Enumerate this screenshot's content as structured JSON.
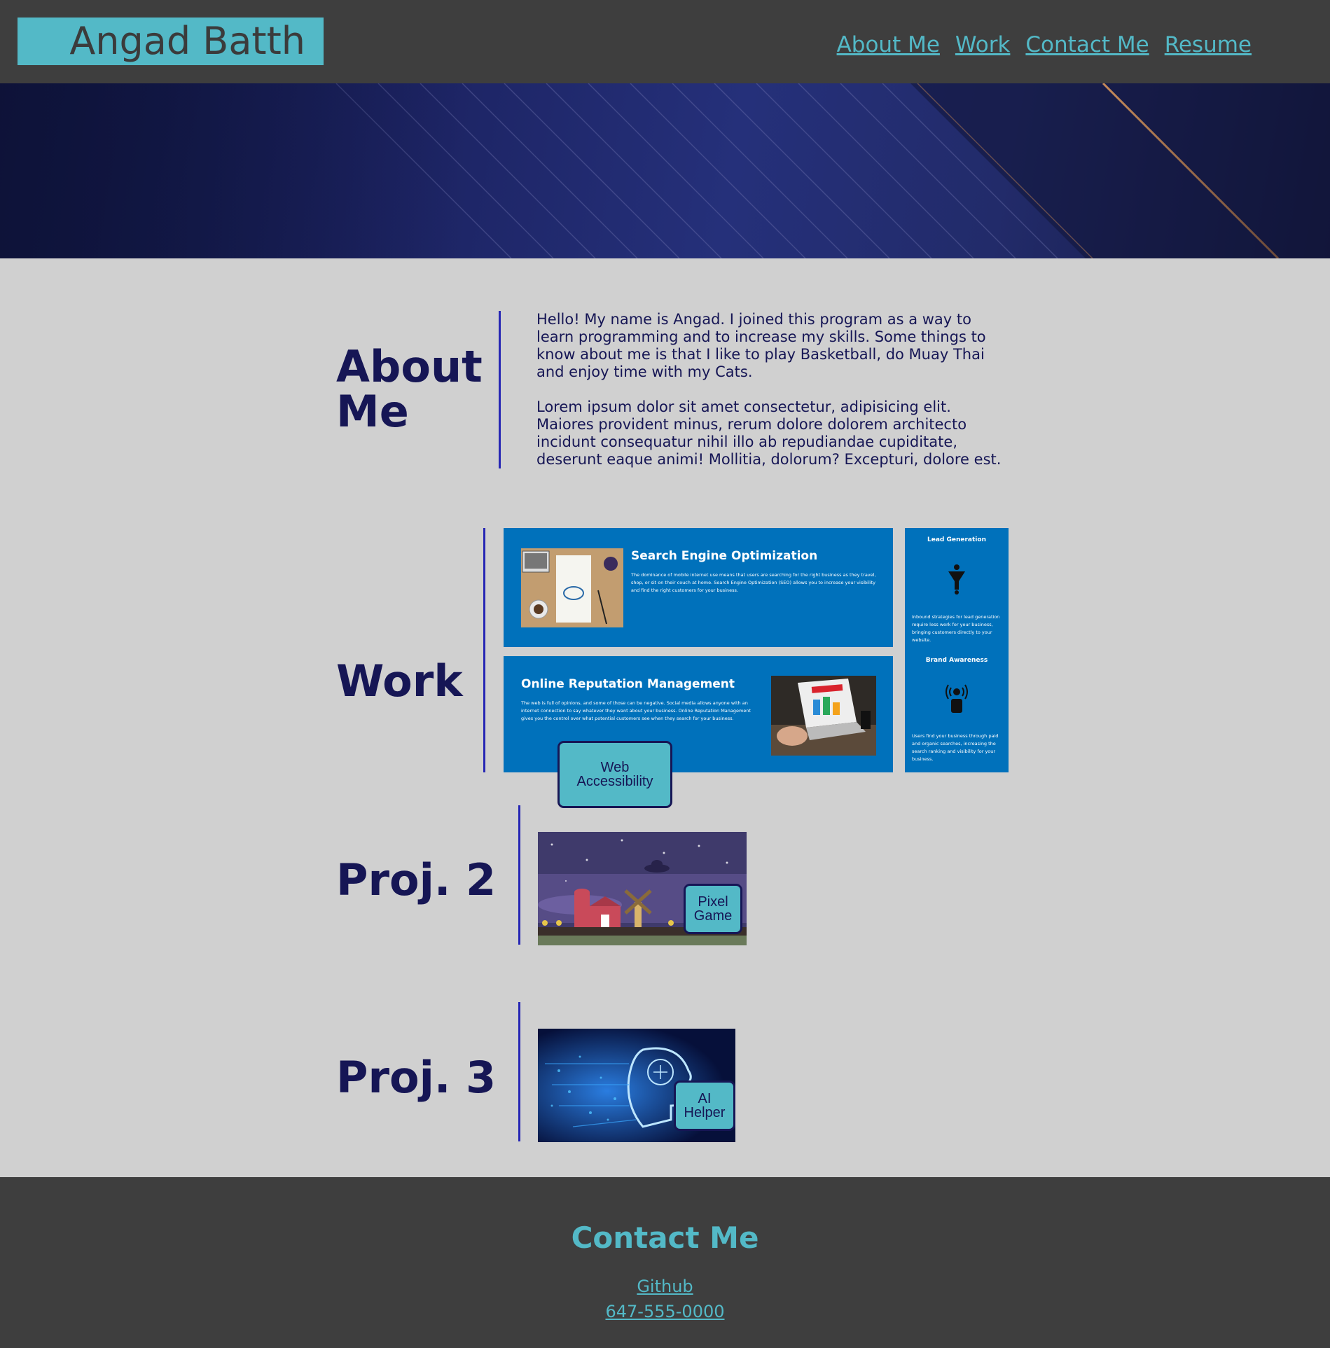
{
  "header": {
    "logo": "Angad Batth",
    "nav": [
      "About Me",
      "Work",
      "Contact Me",
      "Resume"
    ]
  },
  "about": {
    "title_line1": "About",
    "title_line2": "Me",
    "paragraph1": "Hello! My name is Angad. I joined this program as a way to learn programming and to increase my skills. Some things to know about me is that I like to play Basketball, do Muay Thai and enjoy time with my Cats.",
    "paragraph2": "Lorem ipsum dolor sit amet consectetur, adipisicing elit. Maiores provident minus, rerum dolore dolorem architecto incidunt consequatur nihil illo ab repudiandae cupiditate, deserunt eaque animi! Mollitia, dolorum? Excepturi, dolore est."
  },
  "work": {
    "title": "Work",
    "seo_title": "Search Engine Optimization",
    "seo_desc": "The dominance of mobile internet use means that users are searching for the right business as they travel, shop, or sit on their couch at home. Search Engine Optimization (SEO) allows you to increase your visibility and find the right customers for your business.",
    "orm_title": "Online Reputation Management",
    "orm_desc": "The web is full of opinions, and some of those can be negative. Social media allows anyone with an internet connection to say whatever they want about your business. Online Reputation Management gives you the control over what potential customers see when they search for your business.",
    "lead_title": "Lead Generation",
    "lead_desc": "Inbound strategies for lead generation require less work for your business, bringing customers directly to your website.",
    "brand_title": "Brand Awareness",
    "brand_desc": "Users find your business through paid and organic searches, increasing the search ranking and visibility for your business.",
    "pill_line1": "Web",
    "pill_line2": "Accessibility"
  },
  "proj2": {
    "title": "Proj. 2",
    "pill_line1": "Pixel",
    "pill_line2": "Game"
  },
  "proj3": {
    "title": "Proj. 3",
    "pill_line1": "AI",
    "pill_line2": "Helper"
  },
  "footer": {
    "title": "Contact Me",
    "github": "Github",
    "phone": "647-555-0000"
  },
  "colors": {
    "header_bg": "#3e3e3e",
    "accent": "#53b9c7",
    "navy_text": "#161655",
    "section_bar": "#2626b4",
    "page_bg": "#d0d0d0",
    "panel_blue": "#0071bb"
  }
}
